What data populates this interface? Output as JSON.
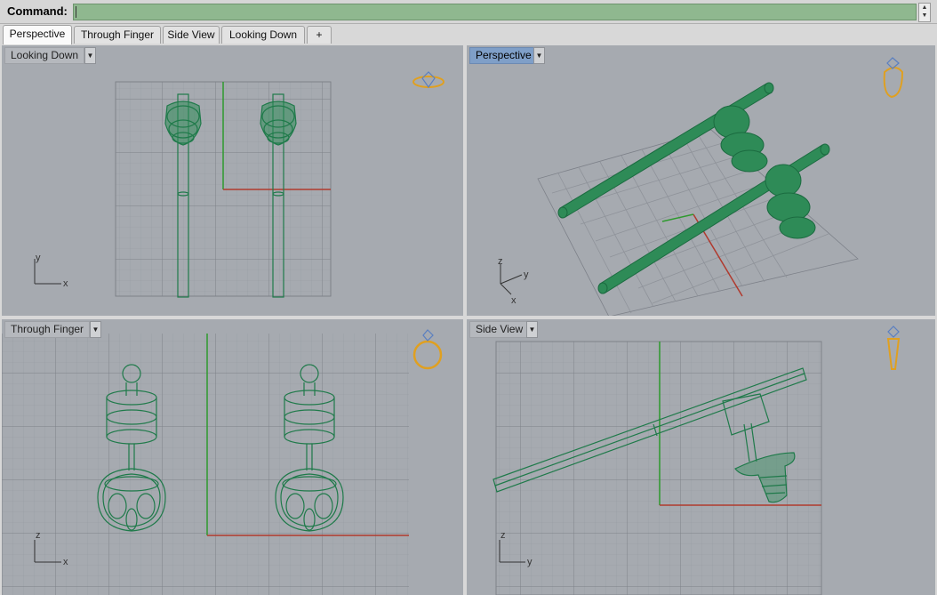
{
  "command": {
    "label": "Command:",
    "value": ""
  },
  "tabs": [
    {
      "label": "Perspective",
      "active": true
    },
    {
      "label": "Through Finger",
      "active": false
    },
    {
      "label": "Side View",
      "active": false
    },
    {
      "label": "Looking Down",
      "active": false
    },
    {
      "label": "+",
      "icon": "add-tab-icon"
    }
  ],
  "viewports": {
    "top_left": {
      "label": "Looking Down",
      "axes": {
        "a": "y",
        "b": "x"
      }
    },
    "top_right": {
      "label": "Perspective",
      "active": true,
      "axes": {
        "a": "z",
        "b": "y",
        "c": "x"
      }
    },
    "bottom_left": {
      "label": "Through Finger",
      "axes": {
        "a": "z",
        "b": "x"
      }
    },
    "bottom_right": {
      "label": "Side View",
      "axes": {
        "a": "z",
        "b": "y"
      }
    }
  },
  "colors": {
    "viewport_bg": "#a6aab0",
    "grid": "#8f939a",
    "model_wire": "#1f7a4a",
    "model_fill": "#2e8b57",
    "x_axis": "#b03a2e",
    "y_axis": "#2e9a2e",
    "ring_icon": "#e0a020",
    "command_bg": "#8fb88f",
    "active_label": "#7f9fc8"
  }
}
